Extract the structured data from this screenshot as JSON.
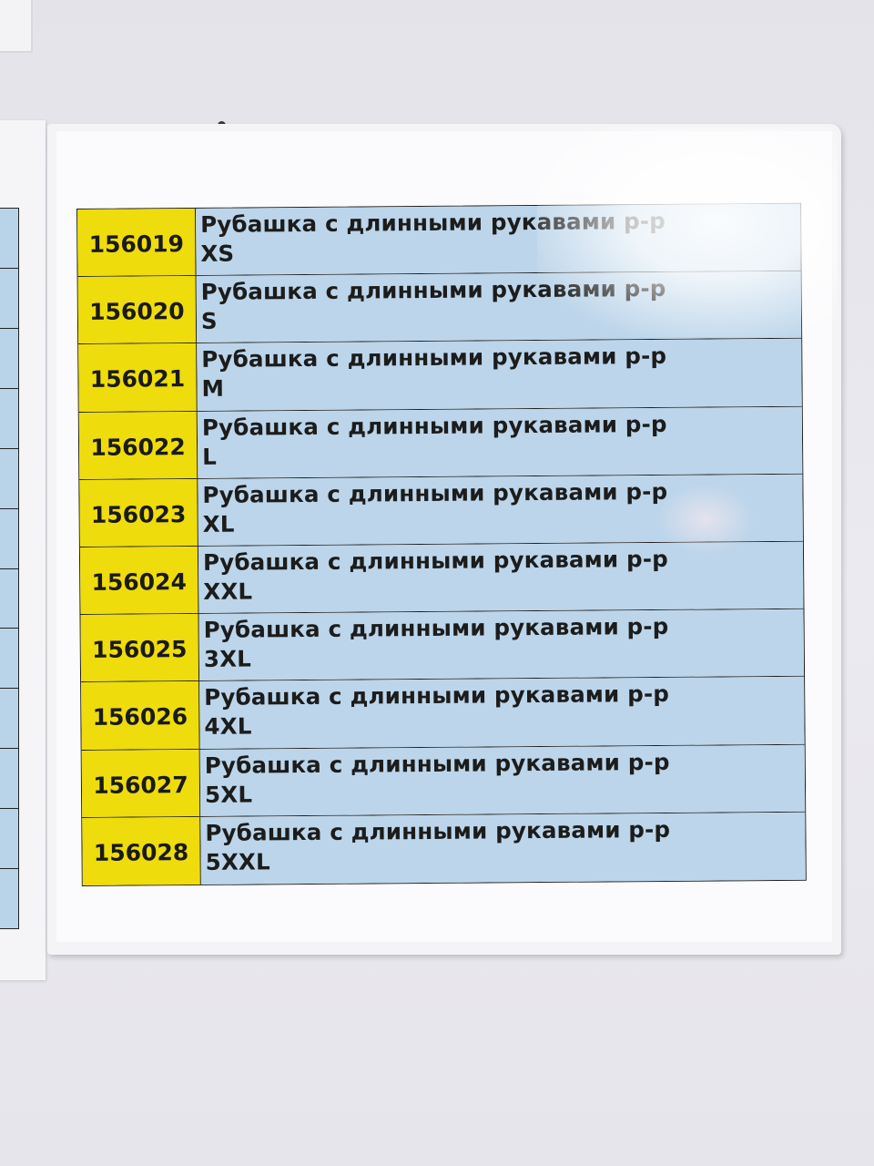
{
  "rows": [
    {
      "code": "156019",
      "name": "Рубашка с длинными рукавами р-р",
      "size": "XS"
    },
    {
      "code": "156020",
      "name": "Рубашка с длинными рукавами р-р",
      "size": "S"
    },
    {
      "code": "156021",
      "name": "Рубашка с длинными рукавами р-р",
      "size": "M"
    },
    {
      "code": "156022",
      "name": "Рубашка с длинными рукавами р-р",
      "size": "L"
    },
    {
      "code": "156023",
      "name": "Рубашка с длинными рукавами р-р",
      "size": "XL"
    },
    {
      "code": "156024",
      "name": "Рубашка с длинными рукавами р-р",
      "size": "XXL"
    },
    {
      "code": "156025",
      "name": "Рубашка с длинными рукавами р-р",
      "size": "3XL"
    },
    {
      "code": "156026",
      "name": "Рубашка с длинными рукавами р-р",
      "size": "4XL"
    },
    {
      "code": "156027",
      "name": "Рубашка с длинными рукавами р-р",
      "size": "5XL"
    },
    {
      "code": "156028",
      "name": "Рубашка с длинными рукавами р-р",
      "size": "5XXL"
    }
  ],
  "colors": {
    "code_cell": "#eedc0c",
    "desc_cell": "#bcd5ea",
    "wall": "#e9e8ee"
  }
}
